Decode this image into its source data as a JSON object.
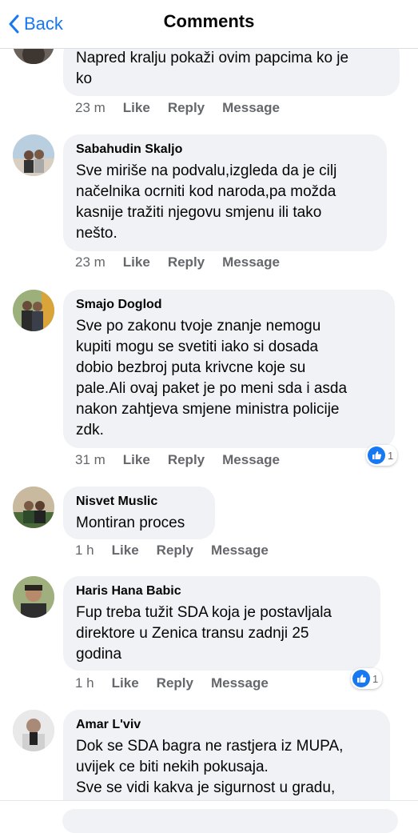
{
  "header": {
    "back_label": "Back",
    "title": "Comments"
  },
  "comments": [
    {
      "name": "",
      "text": "Napred kralju pokaži ovim papcima ko je\nko",
      "time": "23 m",
      "like": "Like",
      "reply": "Reply",
      "message": "Message",
      "reaction_count": ""
    },
    {
      "name": "Sabahudin Skaljo",
      "text": "Sve miriše na podvalu,izgleda da je cilj\nnačelnika ocrniti kod naroda,pa možda\nkasnije tražiti njegovu smjenu ili tako\nnešto.",
      "time": "23 m",
      "like": "Like",
      "reply": "Reply",
      "message": "Message",
      "reaction_count": ""
    },
    {
      "name": "Smajo Doglod",
      "text": "Sve po zakonu tvoje znanje nemogu\nkupiti mogu se svetiti iako si dosada\ndobio bezbroj puta krivcne koje su\npale.Ali ovaj paket je po meni sda i asda\nnakon zahtjeva smjene ministra policije\nzdk.",
      "time": "31 m",
      "like": "Like",
      "reply": "Reply",
      "message": "Message",
      "reaction_count": "1"
    },
    {
      "name": "Nisvet Muslic",
      "text": "Montiran proces",
      "time": "1 h",
      "like": "Like",
      "reply": "Reply",
      "message": "Message",
      "reaction_count": ""
    },
    {
      "name": "Haris Hana Babic",
      "text": "Fup treba tužit SDA koja je postavljala\ndirektore u Zenica transu   zadnji 25\ngodina",
      "time": "1 h",
      "like": "Like",
      "reply": "Reply",
      "message": "Message",
      "reaction_count": "1"
    },
    {
      "name": "Amar L'viv",
      "text": "Dok se SDA bagra ne rastjera iz MUPA,\nuvijek ce biti nekih pokusaja.\nSve se vidi kakva je sigurnost u gradu,",
      "time": "",
      "like": "",
      "reply": "",
      "message": "",
      "reaction_count": ""
    }
  ],
  "icons": {
    "back": "chevron-left-icon",
    "reaction": "like-reaction-icon"
  },
  "colors": {
    "accent": "#1877f2",
    "bubble": "#f0f2f5",
    "meta": "#65676b"
  }
}
